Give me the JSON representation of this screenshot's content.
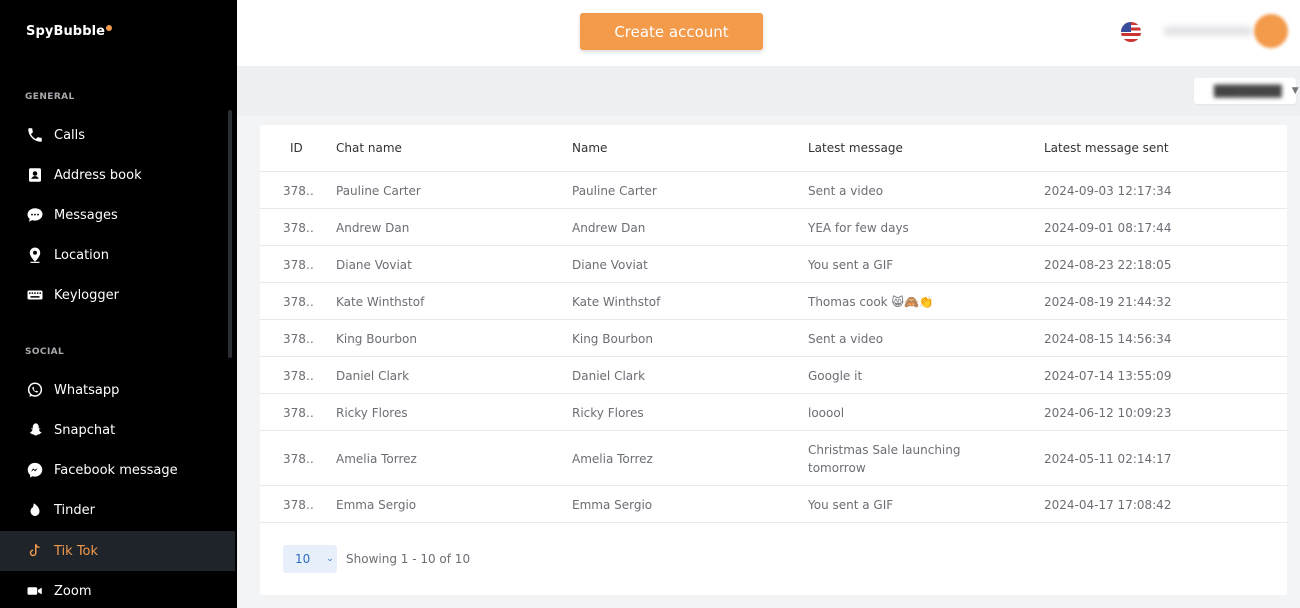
{
  "brand": {
    "name": "SpyBubble"
  },
  "sidebar": {
    "general_label": "GENERAL",
    "social_label": "SOCIAL",
    "general_items": [
      {
        "label": "Calls",
        "icon": "phone-icon"
      },
      {
        "label": "Address book",
        "icon": "address-book-icon"
      },
      {
        "label": "Messages",
        "icon": "chat-bubble-icon"
      },
      {
        "label": "Location",
        "icon": "location-pin-icon"
      },
      {
        "label": "Keylogger",
        "icon": "keyboard-icon"
      }
    ],
    "social_items": [
      {
        "label": "Whatsapp",
        "icon": "whatsapp-icon"
      },
      {
        "label": "Snapchat",
        "icon": "snapchat-icon"
      },
      {
        "label": "Facebook message",
        "icon": "messenger-icon"
      },
      {
        "label": "Tinder",
        "icon": "tinder-flame-icon"
      },
      {
        "label": "Tik Tok",
        "icon": "tiktok-icon",
        "active": true
      },
      {
        "label": "Zoom",
        "icon": "video-camera-icon"
      }
    ]
  },
  "header": {
    "create_button": "Create account"
  },
  "colors": {
    "accent": "#f39a4b",
    "sidebar_bg": "#000000",
    "active_bg": "#1f232a"
  },
  "table": {
    "columns": [
      "ID",
      "Chat name",
      "Name",
      "Latest message",
      "Latest message sent"
    ],
    "rows": [
      {
        "id": "378…",
        "chat": "Pauline Carter",
        "name": "Pauline Carter",
        "msg": "Sent a video",
        "sent": "2024-09-03 12:17:34"
      },
      {
        "id": "378…",
        "chat": "Andrew Dan",
        "name": "Andrew Dan",
        "msg": "YEA for few days",
        "sent": "2024-09-01 08:17:44"
      },
      {
        "id": "378…",
        "chat": "Diane Voviat",
        "name": "Diane Voviat",
        "msg": "You sent a GIF",
        "sent": "2024-08-23 22:18:05"
      },
      {
        "id": "378…",
        "chat": "Kate Winthstof",
        "name": "Kate Winthstof",
        "msg": "Thomas cook 😸🙈👏",
        "sent": "2024-08-19 21:44:32"
      },
      {
        "id": "378…",
        "chat": "King Bourbon",
        "name": "King Bourbon",
        "msg": "Sent a video",
        "sent": "2024-08-15 14:56:34"
      },
      {
        "id": "378…",
        "chat": "Daniel Clark",
        "name": "Daniel Clark",
        "msg": "Google it",
        "sent": "2024-07-14 13:55:09"
      },
      {
        "id": "378…",
        "chat": "Ricky Flores",
        "name": "Ricky Flores",
        "msg": "looool",
        "sent": "2024-06-12 10:09:23"
      },
      {
        "id": "378…",
        "chat": "Amelia Torrez",
        "name": "Amelia Torrez",
        "msg": "Christmas Sale launching tomorrow",
        "sent": "2024-05-11 02:14:17"
      },
      {
        "id": "378…",
        "chat": "Emma Sergio",
        "name": "Emma Sergio",
        "msg": "You sent a GIF",
        "sent": "2024-04-17 17:08:42"
      }
    ]
  },
  "pagination": {
    "page_size": "10",
    "showing": "Showing 1 - 10 of 10"
  }
}
